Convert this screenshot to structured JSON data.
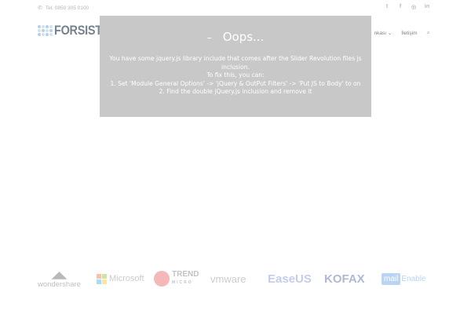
{
  "topbar": {
    "phone": "Tel: 0850 305 0100",
    "phone_icon": "phone-icon",
    "social": [
      {
        "name": "twitter-icon",
        "glyph": "t"
      },
      {
        "name": "facebook-icon",
        "glyph": "f"
      },
      {
        "name": "instagram-icon",
        "glyph": "◎"
      },
      {
        "name": "linkedin-icon",
        "glyph": "in"
      }
    ]
  },
  "header": {
    "logo_text": "FORSIST",
    "nav": {
      "partial_item": "nkası",
      "partial_chevron": "⌄",
      "contact": "İletişim"
    }
  },
  "dialog": {
    "dash": "–",
    "title": "Oops...",
    "lines": [
      "You have some jquery.js library include that comes after the Slider Revolution files js",
      "inclusion.",
      "To fix this, you can:",
      "1. Set 'Module General Options' -> 'jQuery & OutPut Filters' -> 'Put JS to Body' to on",
      "2. Find the double jQuery.js inclusion and remove it"
    ]
  },
  "partners": {
    "wondershare": "wondershare",
    "microsoft": "Microsoft",
    "trend_top": "TREND",
    "trend_bottom": "MICRO",
    "vmware": "vmware",
    "easeus": "EaseUS",
    "kofax": "KOFAX",
    "mailenable_box": "mail",
    "mailenable_rest": "Enable"
  },
  "colors": {
    "dialog_bg": "#c8c8c8",
    "microsoft": [
      "#f25022",
      "#7fba00",
      "#00a4ef",
      "#ffb900"
    ]
  }
}
